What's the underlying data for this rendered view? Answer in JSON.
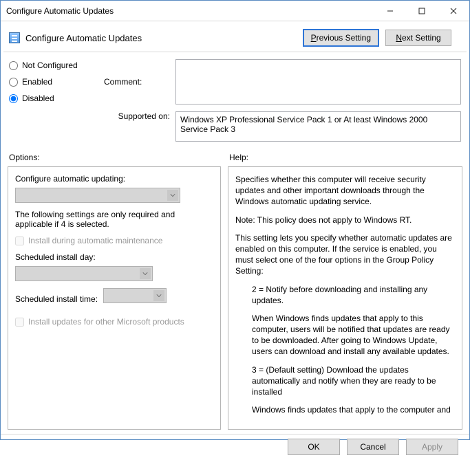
{
  "window": {
    "title": "Configure Automatic Updates"
  },
  "header": {
    "title": "Configure Automatic Updates",
    "prev_label_pre": "P",
    "prev_label_post": "revious Setting",
    "next_label_pre": "N",
    "next_label_post": "ext Setting"
  },
  "radios": {
    "not_configured": "Not Configured",
    "enabled": "Enabled",
    "disabled": "Disabled",
    "selected": "disabled"
  },
  "meta": {
    "comment_label": "Comment:",
    "comment_value": "",
    "supported_label": "Supported on:",
    "supported_value": "Windows XP Professional Service Pack 1 or At least Windows 2000 Service Pack 3"
  },
  "columns": {
    "options_label": "Options:",
    "help_label": "Help:"
  },
  "options": {
    "configure_label": "Configure automatic updating:",
    "note": "The following settings are only required and applicable if 4 is selected.",
    "chk_maintenance": "Install during automatic maintenance",
    "sched_day_label": "Scheduled install day:",
    "sched_time_label": "Scheduled install time:",
    "chk_other_products": "Install updates for other Microsoft products"
  },
  "help": {
    "p1": "Specifies whether this computer will receive security updates and other important downloads through the Windows automatic updating service.",
    "p2": "Note: This policy does not apply to Windows RT.",
    "p3": "This setting lets you specify whether automatic updates are enabled on this computer. If the service is enabled, you must select one of the four options in the Group Policy Setting:",
    "p4": "2 = Notify before downloading and installing any updates.",
    "p5": "When Windows finds updates that apply to this computer, users will be notified that updates are ready to be downloaded. After going to Windows Update, users can download and install any available updates.",
    "p6": "3 = (Default setting) Download the updates automatically and notify when they are ready to be installed",
    "p7": "Windows finds updates that apply to the computer and"
  },
  "footer": {
    "ok": "OK",
    "cancel": "Cancel",
    "apply": "Apply"
  }
}
